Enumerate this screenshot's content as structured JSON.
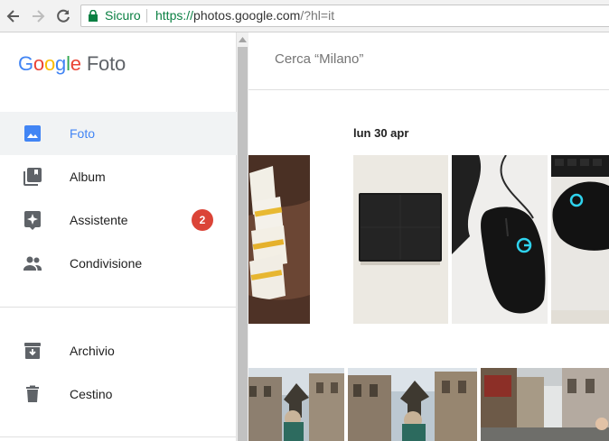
{
  "browser": {
    "secure_label": "Sicuro",
    "url_scheme": "https://",
    "url_host": "photos.google.com",
    "url_rest": "/?hl=it"
  },
  "logo": {
    "letters": [
      "G",
      "o",
      "o",
      "g",
      "l",
      "e"
    ],
    "product": "Foto"
  },
  "search": {
    "placeholder": "Cerca “Milano”"
  },
  "sidebar": {
    "items": [
      {
        "label": "Foto",
        "icon": "photo-icon"
      },
      {
        "label": "Album",
        "icon": "album-icon"
      },
      {
        "label": "Assistente",
        "icon": "assistant-icon",
        "badge": "2"
      },
      {
        "label": "Condivisione",
        "icon": "people-icon"
      },
      {
        "label": "Archivio",
        "icon": "archive-icon"
      },
      {
        "label": "Cestino",
        "icon": "trash-icon"
      }
    ]
  },
  "main": {
    "date_label": "lun 30 apr"
  },
  "colors": {
    "accent": "#4285f4",
    "badge": "#db4437",
    "secure": "#0b8043"
  }
}
